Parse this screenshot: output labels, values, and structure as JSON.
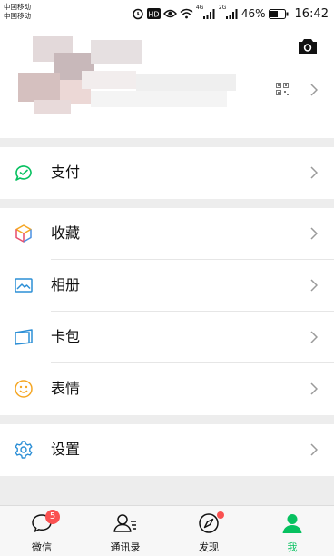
{
  "status_bar": {
    "carrier_1": "中国移动",
    "carrier_2": "中国移动",
    "net_4g": "4G",
    "net_2g": "2G",
    "battery": "46%",
    "time": "16:42"
  },
  "menu": {
    "pay": "支付",
    "favorites": "收藏",
    "album": "相册",
    "cards": "卡包",
    "stickers": "表情",
    "settings": "设置"
  },
  "tabbar": {
    "chats": "微信",
    "chats_badge": "5",
    "contacts": "通讯录",
    "discover": "发现",
    "me": "我"
  },
  "colors": {
    "accent": "#07c160",
    "badge": "#fa5151",
    "background": "#ededed"
  }
}
